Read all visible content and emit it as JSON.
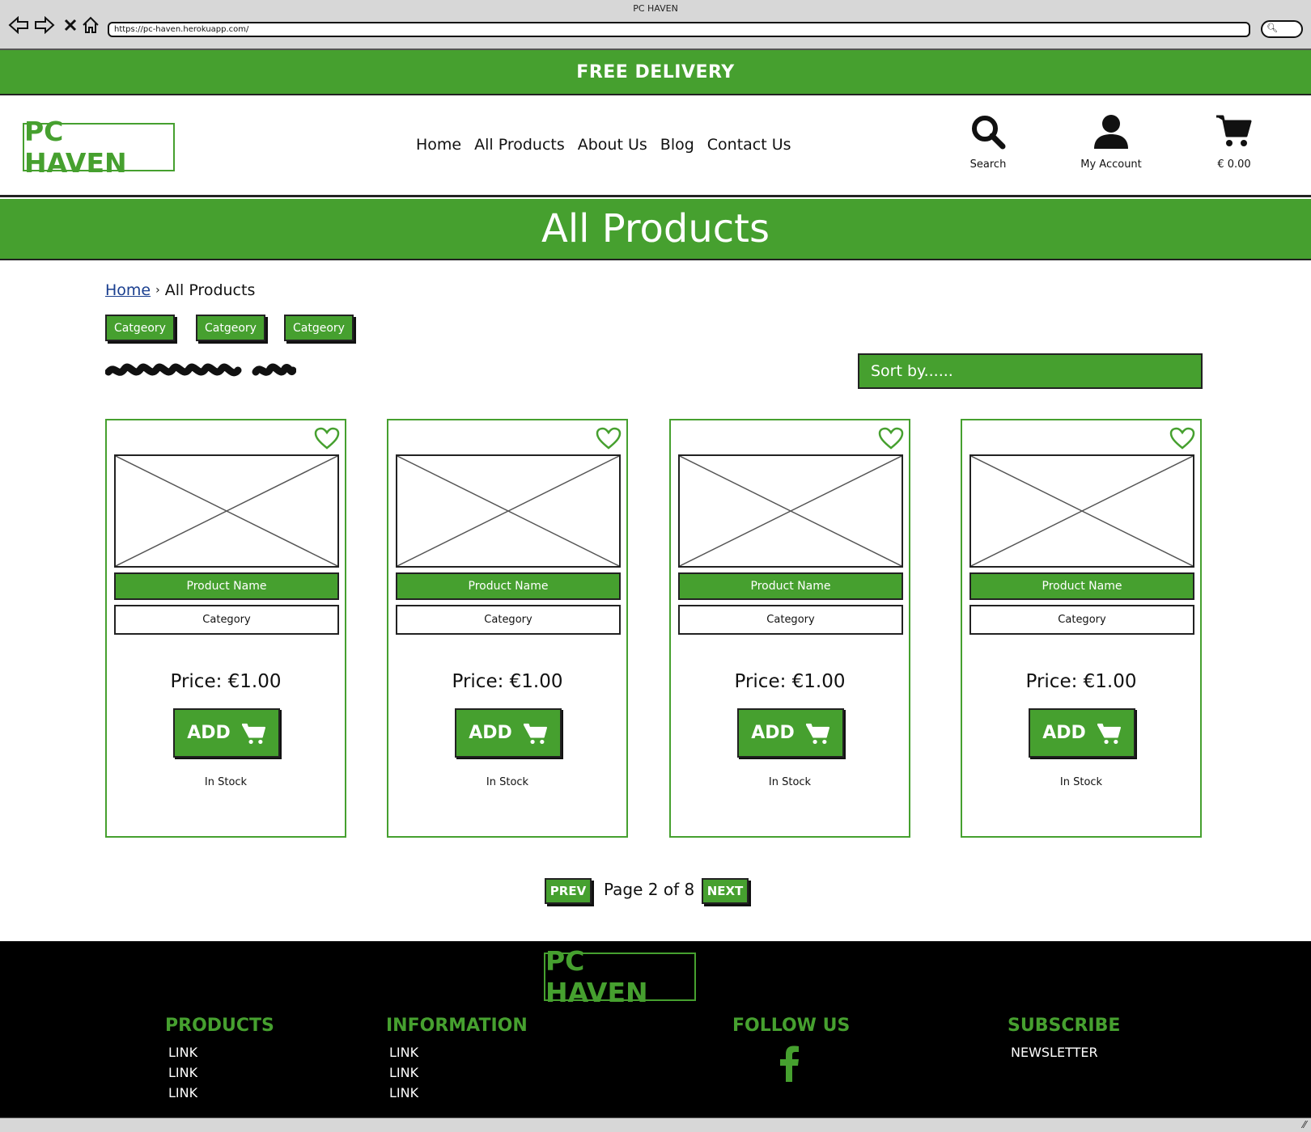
{
  "browser": {
    "title": "PC HAVEN",
    "url": "https://pc-haven.herokuapp.com/"
  },
  "promo": {
    "text": "FREE DELIVERY"
  },
  "header": {
    "logo": "PC HAVEN",
    "nav": [
      "Home",
      "All Products",
      "About Us",
      "Blog",
      "Contact Us"
    ],
    "search_label": "Search",
    "account_label": "My Account",
    "cart_total": "€ 0.00"
  },
  "page": {
    "title": "All Products",
    "breadcrumb": {
      "home": "Home",
      "separator": "›",
      "current": "All Products"
    },
    "categories": [
      "Catgeory",
      "Catgeory",
      "Catgeory"
    ],
    "sort_placeholder": "Sort by......"
  },
  "products": [
    {
      "name": "Product Name",
      "category": "Category",
      "price": "Price: €1.00",
      "button": "ADD",
      "stock": "In Stock"
    },
    {
      "name": "Product Name",
      "category": "Category",
      "price": "Price: €1.00",
      "button": "ADD",
      "stock": "In Stock"
    },
    {
      "name": "Product Name",
      "category": "Category",
      "price": "Price: €1.00",
      "button": "ADD",
      "stock": "In Stock"
    },
    {
      "name": "Product Name",
      "category": "Category",
      "price": "Price: €1.00",
      "button": "ADD",
      "stock": "In Stock"
    }
  ],
  "pagination": {
    "prev": "PREV",
    "text": "Page 2 of 8",
    "next": "NEXT"
  },
  "footer": {
    "logo": "PC HAVEN",
    "products": {
      "heading": "PRODUCTS",
      "links": [
        "LINK",
        "LINK",
        "LINK"
      ]
    },
    "information": {
      "heading": "INFORMATION",
      "links": [
        "LINK",
        "LINK",
        "LINK"
      ]
    },
    "follow": {
      "heading": "FOLLOW US",
      "icon": "facebook-icon"
    },
    "subscribe": {
      "heading": "SUBSCRIBE",
      "link": "NEWSLETTER"
    }
  },
  "colors": {
    "brand_green": "#46a02f",
    "footer_bg": "#000000",
    "link_blue": "#1a3f8f"
  }
}
